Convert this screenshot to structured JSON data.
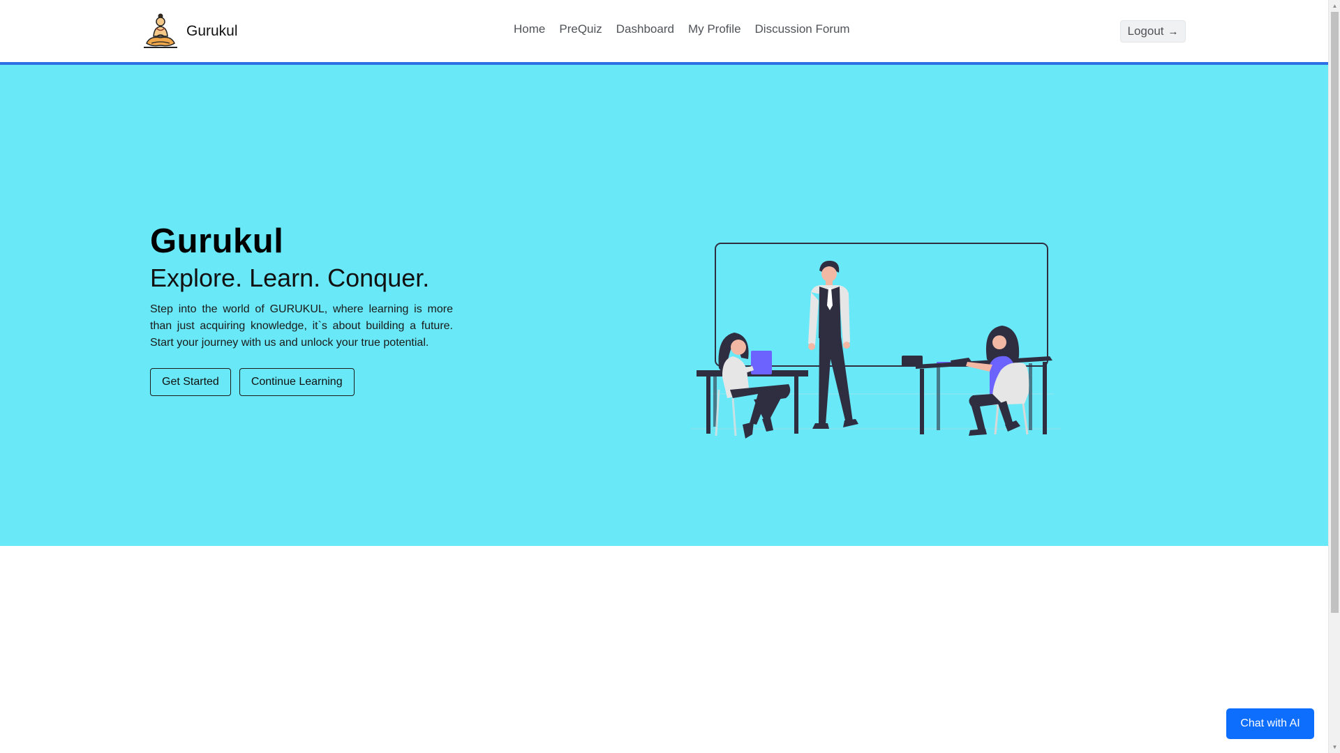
{
  "navbar": {
    "brand_name": "Gurukul",
    "brand_logo_icon": "meditating-sage-icon",
    "links": [
      {
        "label": "Home"
      },
      {
        "label": "PreQuiz"
      },
      {
        "label": "Dashboard"
      },
      {
        "label": "My Profile"
      },
      {
        "label": "Discussion Forum"
      }
    ],
    "logout_label": "Logout",
    "logout_icon": "arrow-right-icon"
  },
  "hero": {
    "title": "Gurukul",
    "subtitle": "Explore. Learn. Conquer.",
    "description": "Step into the world of GURUKUL, where learning is more than just acquiring knowledge, it`s about building a future. Start your journey with us and unlock your true potential.",
    "buttons": {
      "get_started": "Get Started",
      "continue_learning": "Continue Learning"
    },
    "illustration_icon": "classroom-illustration",
    "background_color": "#69e8f7"
  },
  "chat": {
    "label": "Chat with AI"
  },
  "colors": {
    "accent": "#0d6efd",
    "navbar_border": "#2f6fe4",
    "illustration_purple": "#6c63ff",
    "illustration_dark": "#2f2e41"
  }
}
